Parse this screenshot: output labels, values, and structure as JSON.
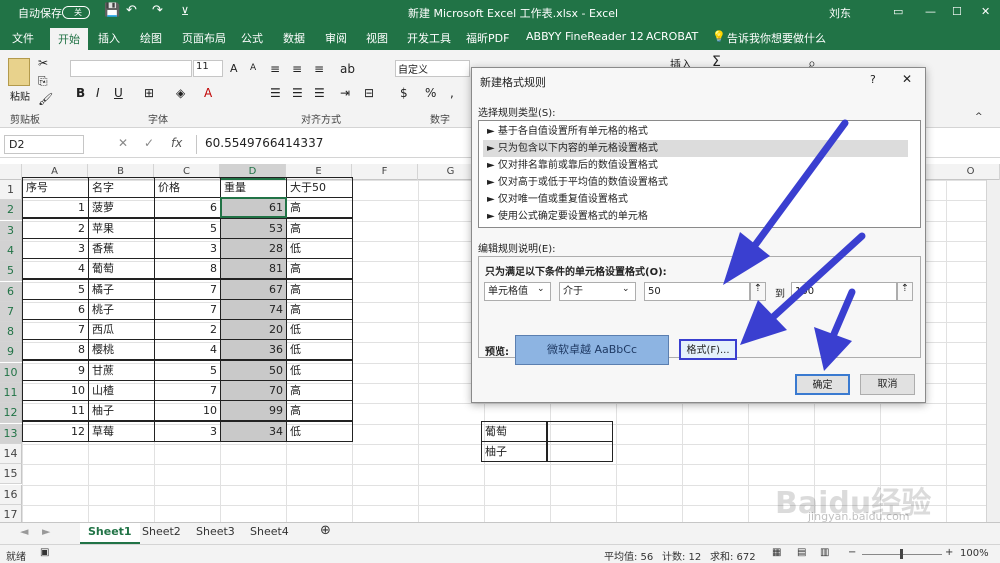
{
  "titlebar": {
    "autosave": "自动保存",
    "autosave_state": "关",
    "title": "新建 Microsoft Excel 工作表.xlsx  -  Excel",
    "user": "刘东"
  },
  "tabs": [
    "文件",
    "开始",
    "插入",
    "绘图",
    "页面布局",
    "公式",
    "数据",
    "审阅",
    "视图",
    "开发工具",
    "福昕PDF",
    "ABBYY FineReader 12",
    "ACROBAT",
    "告诉我你想要做什么"
  ],
  "ribbon": {
    "paste": "粘贴",
    "clipboard": "剪贴板",
    "font": "字体",
    "align": "对齐方式",
    "number": "数字",
    "font_size": "11",
    "number_format": "自定义",
    "insert": "插入"
  },
  "formula_bar": {
    "name_box": "D2",
    "formula": "60.5549766414337",
    "fx": "fx"
  },
  "columns": [
    "A",
    "B",
    "C",
    "D",
    "E",
    "F",
    "G",
    "O"
  ],
  "rows": [
    "1",
    "2",
    "3",
    "4",
    "5",
    "6",
    "7",
    "8",
    "9",
    "10",
    "11",
    "12",
    "13",
    "14",
    "15",
    "16",
    "17"
  ],
  "headers": [
    "序号",
    "名字",
    "价格",
    "重量",
    "大于50"
  ],
  "table": [
    [
      "1",
      "菠萝",
      "6",
      "61",
      "高"
    ],
    [
      "2",
      "苹果",
      "5",
      "53",
      "高"
    ],
    [
      "3",
      "香蕉",
      "3",
      "28",
      "低"
    ],
    [
      "4",
      "葡萄",
      "8",
      "81",
      "高"
    ],
    [
      "5",
      "橘子",
      "7",
      "67",
      "高"
    ],
    [
      "6",
      "桃子",
      "7",
      "74",
      "高"
    ],
    [
      "7",
      "西瓜",
      "2",
      "20",
      "低"
    ],
    [
      "8",
      "樱桃",
      "4",
      "36",
      "低"
    ],
    [
      "9",
      "甘蔗",
      "5",
      "50",
      "低"
    ],
    [
      "10",
      "山楂",
      "7",
      "70",
      "高"
    ],
    [
      "11",
      "柚子",
      "10",
      "99",
      "高"
    ],
    [
      "12",
      "草莓",
      "3",
      "34",
      "低"
    ]
  ],
  "side_cells": [
    "葡萄",
    "柚子"
  ],
  "dialog": {
    "title": "新建格式规则",
    "help": "?",
    "close": "✕",
    "select_type_label": "选择规则类型(S):",
    "rule_types": [
      "► 基于各自值设置所有单元格的格式",
      "► 只为包含以下内容的单元格设置格式",
      "► 仅对排名靠前或靠后的数值设置格式",
      "► 仅对高于或低于平均值的数值设置格式",
      "► 仅对唯一值或重复值设置格式",
      "► 使用公式确定要设置格式的单元格"
    ],
    "edit_label": "编辑规则说明(E):",
    "condition_label": "只为满足以下条件的单元格设置格式(O):",
    "cond1": "单元格值",
    "cond2": "介于",
    "value1": "50",
    "to": "到",
    "value2": "100",
    "preview_label": "预览:",
    "preview_text": "微软卓越  AaBbCc",
    "format_button": "格式(F)...",
    "ok": "确定",
    "cancel": "取消"
  },
  "sheets": [
    "Sheet1",
    "Sheet2",
    "Sheet3",
    "Sheet4"
  ],
  "status": {
    "mode": "就绪",
    "avg": "平均值: 56",
    "count": "计数: 12",
    "sum": "求和: 672",
    "zoom": "100%"
  },
  "watermark": {
    "brand": "Baidu经验",
    "url": "jingyan.baidu.com"
  },
  "colors": {
    "excel_green": "#217346",
    "arrow": "#3a3fd0",
    "preview_bg": "#8db4e2",
    "selected_fill": "#c9c9c9"
  }
}
